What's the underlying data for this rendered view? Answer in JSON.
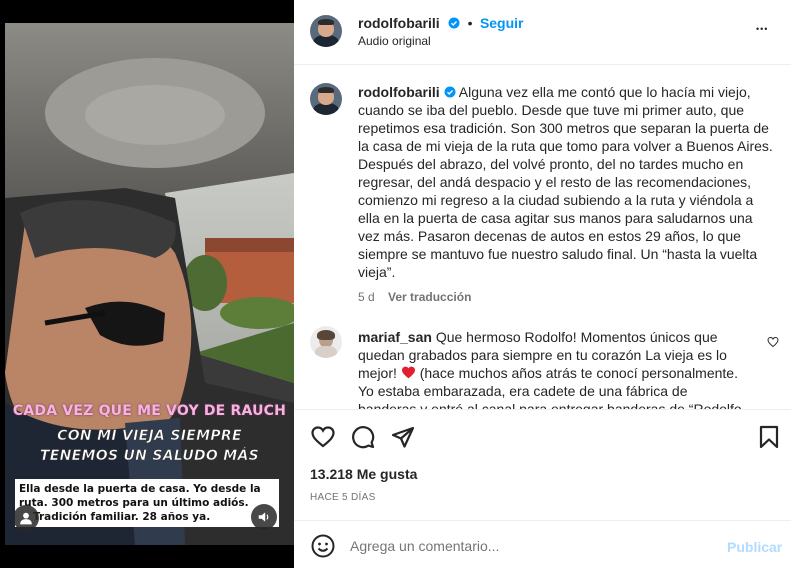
{
  "post": {
    "username": "rodolfobarili",
    "follow_label": "Seguir",
    "separator": "•",
    "audio": "Audio original",
    "more_label": "•••",
    "caption": "Alguna vez ella me contó que lo hacía mi viejo, cuando se iba del pueblo. Desde que tuve mi primer auto, que repetimos esa tradición. Son 300 metros que separan la puerta de la casa de mi vieja de la ruta que tomo para volver a Buenos Aires. Después del abrazo, del volvé pronto, del no tardes mucho en regresar, del andá despacio y el resto de las recomendaciones, comienzo mi regreso a la ciudad subiendo a la ruta y viéndola a ella en la puerta de casa agitar sus manos para saludarnos una vez más. Pasaron decenas de autos en estos 29 años, lo que siempre se mantuvo fue nuestro saludo final. Un “hasta la vuelta vieja”.",
    "caption_age": "5 d",
    "translate_label": "Ver traducción",
    "likes": "13.218 Me gusta",
    "timestamp": "HACE 5 DÍAS"
  },
  "comment": {
    "username": "mariaf_san",
    "text_before_heart": "Que hermoso Rodolfo! Momentos únicos que quedan grabados para siempre en tu corazón La vieja es lo mejor!",
    "text_after_heart": "(hace muchos años atrás te conocí personalmente. Yo estaba embarazada, era cadete de una fábrica de banderas",
    "text_cut": "y entré al canal para entregar banderas de “Rodolfo Barili”..."
  },
  "video_overlay": {
    "line1": "CADA VEZ QUE ME VOY DE RAUCH",
    "line2": "CON MI VIEJA SIEMPRE",
    "line3": "TENEMOS UN SALUDO MÁS",
    "caption_line1": "Ella desde la puerta de casa. Yo desde la",
    "caption_line2": "ruta. 300 metros para un último adiós.",
    "caption_line3": "Tradición familiar. 28 años ya."
  },
  "add_comment": {
    "placeholder": "Agrega un comentario...",
    "publish_label": "Publicar"
  },
  "icons": {
    "verified": "verified-badge-icon",
    "like": "heart-icon",
    "comment": "comment-bubble-icon",
    "share": "paper-plane-icon",
    "save": "bookmark-icon",
    "emoji": "smiley-icon",
    "tag": "person-tag-icon",
    "mute": "speaker-icon"
  },
  "colors": {
    "accent": "#0095f6",
    "publish_disabled": "#b3dbff",
    "heart_red": "#ed4956",
    "overlay_pink": "#f6b3e0"
  }
}
